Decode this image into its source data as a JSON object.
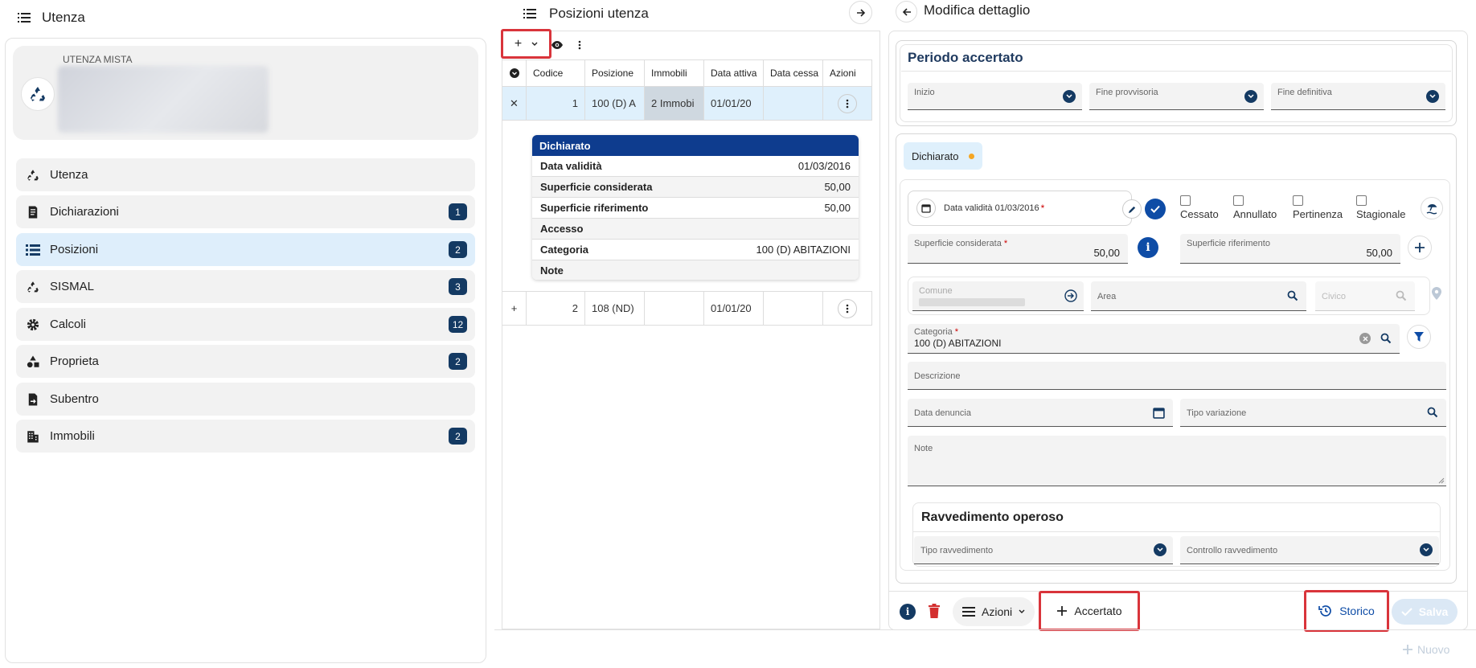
{
  "left": {
    "title": "Utenza",
    "user_type": "UTENZA MISTA",
    "nav": [
      {
        "label": "Utenza",
        "badge": "",
        "icon": "recycle-icon"
      },
      {
        "label": "Dichiarazioni",
        "badge": "1",
        "icon": "document-icon"
      },
      {
        "label": "Posizioni",
        "badge": "2",
        "icon": "list-icon"
      },
      {
        "label": "SISMAL",
        "badge": "3",
        "icon": "recycle-icon"
      },
      {
        "label": "Calcoli",
        "badge": "12",
        "icon": "gear-icon"
      },
      {
        "label": "Proprieta",
        "badge": "2",
        "icon": "shapes-icon"
      },
      {
        "label": "Subentro",
        "badge": "",
        "icon": "file-transfer-icon"
      },
      {
        "label": "Immobili",
        "badge": "2",
        "icon": "building-icon"
      }
    ]
  },
  "middle": {
    "title": "Posizioni utenza",
    "columns": [
      "Codice",
      "Posizione",
      "Immobili",
      "Data attiva",
      "Data cessa",
      "Azioni"
    ],
    "rows": [
      {
        "toggle": "✕",
        "codice": "1",
        "posizione": "100 (D) A",
        "immobili": "2 Immobi",
        "data_attiva": "01/01/20",
        "data_cessa": ""
      },
      {
        "toggle": "+",
        "codice": "2",
        "posizione": "108 (ND)",
        "immobili": "",
        "data_attiva": "01/01/20",
        "data_cessa": ""
      }
    ],
    "detail": {
      "header": "Dichiarato",
      "rows": [
        {
          "label": "Data validità",
          "value": "01/03/2016"
        },
        {
          "label": "Superficie considerata",
          "value": "50,00"
        },
        {
          "label": "Superficie riferimento",
          "value": "50,00"
        },
        {
          "label": "Accesso",
          "value": ""
        },
        {
          "label": "Categoria",
          "value": "100 (D) ABITAZIONI"
        },
        {
          "label": "Note",
          "value": ""
        }
      ]
    }
  },
  "right": {
    "title": "Modifica dettaglio",
    "periodo": {
      "title": "Periodo accertato",
      "inizio": "Inizio",
      "fine_provvisoria": "Fine provvisoria",
      "fine_definitiva": "Fine definitiva"
    },
    "chip": "Dichiarato",
    "data_validita": "Data validità 01/03/2016",
    "checks": [
      "Cessato",
      "Annullato",
      "Pertinenza",
      "Stagionale"
    ],
    "superficie_considerata": {
      "label": "Superficie considerata",
      "value": "50,00"
    },
    "superficie_riferimento": {
      "label": "Superficie riferimento",
      "value": "50,00"
    },
    "comune": "Comune",
    "area": "Area",
    "civico": "Civico",
    "categoria": {
      "label": "Categoria",
      "value": "100 (D) ABITAZIONI"
    },
    "descrizione": "Descrizione",
    "data_denuncia": "Data denuncia",
    "tipo_variazione": "Tipo variazione",
    "note": "Note",
    "ravvedimento": {
      "title": "Ravvedimento operoso",
      "tipo": "Tipo ravvedimento",
      "controllo": "Controllo ravvedimento"
    },
    "footer": {
      "azioni": "Azioni",
      "accertato": "Accertato",
      "storico": "Storico",
      "salva": "Salva"
    }
  },
  "bottom": {
    "nuovo": "Nuovo"
  },
  "colors": {
    "navy": "#143a63",
    "highlight": "#d9343b",
    "active": "#deeefb",
    "orange": "#f5a623"
  }
}
